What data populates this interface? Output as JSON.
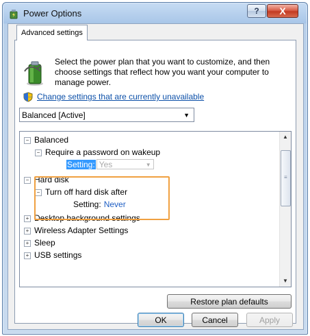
{
  "window": {
    "title": "Power Options"
  },
  "titlebar": {
    "help_label": "?",
    "close_label": "X"
  },
  "tabs": [
    {
      "label": "Advanced settings"
    }
  ],
  "intro": {
    "text": "Select the power plan that you want to customize, and then choose settings that reflect how you want your computer to manage power."
  },
  "change_link": "Change settings that are currently unavailable",
  "plan_select": {
    "value": "Balanced [Active]"
  },
  "tree": {
    "expand_symbol": "+",
    "collapse_symbol": "−",
    "balanced": "Balanced",
    "require_password": "Require a password on wakeup",
    "require_setting_label": "Setting:",
    "require_setting_value": "Yes",
    "hard_disk": "Hard disk",
    "turn_off_disk": "Turn off hard disk after",
    "disk_setting_label": "Setting:",
    "disk_setting_value": "Never",
    "desktop_bg": "Desktop background settings",
    "wireless": "Wireless Adapter Settings",
    "sleep": "Sleep",
    "usb": "USB settings"
  },
  "buttons": {
    "restore": "Restore plan defaults",
    "ok": "OK",
    "cancel": "Cancel",
    "apply": "Apply"
  },
  "colors": {
    "link": "#0b4fa8",
    "selection": "#3399ff",
    "setting_value": "#1f5fc4",
    "highlight_box": "#f0a040"
  }
}
